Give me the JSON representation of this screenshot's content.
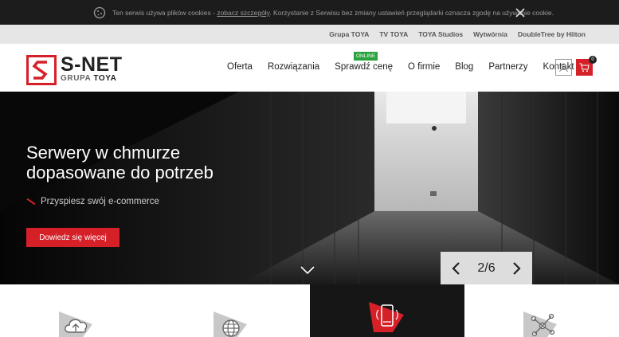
{
  "cookie": {
    "text_before": "Ten serwis używa plików cookies - ",
    "link": "zobacz szczegóły",
    "text_after": ". Korzystanie z Serwisu bez zmiany ustawień przeglądarki oznacza zgodę na używanie cookie."
  },
  "group_links": [
    "Grupa TOYA",
    "TV TOYA",
    "TOYA Studios",
    "Wytwórnia",
    "DoubleTree by Hilton"
  ],
  "logo": {
    "main": "S-NET",
    "sub_prefix": "GRUPA ",
    "sub_brand": "TOYA"
  },
  "nav": {
    "items": [
      "Oferta",
      "Rozwiązania",
      "Sprawdź cenę",
      "O firmie",
      "Blog",
      "Partnerzy",
      "Kontakt"
    ],
    "badge": "ONLINE"
  },
  "cart": {
    "count": "0"
  },
  "hero": {
    "title_line1": "Serwery w chmurze",
    "title_line2": "dopasowane do potrzeb",
    "bullet": "Przyspiesz swój e-commerce",
    "button": "Dowiedz się więcej",
    "slide_counter": "2/6"
  },
  "features": [
    {
      "icon": "cloud-upload-icon",
      "active": false
    },
    {
      "icon": "globe-icon",
      "active": false
    },
    {
      "icon": "mobile-phone-icon",
      "active": true
    },
    {
      "icon": "network-nodes-icon",
      "active": false
    }
  ],
  "colors": {
    "brand_red": "#d52028",
    "online_green": "#2aa33e",
    "dark": "#1c1c1c"
  }
}
